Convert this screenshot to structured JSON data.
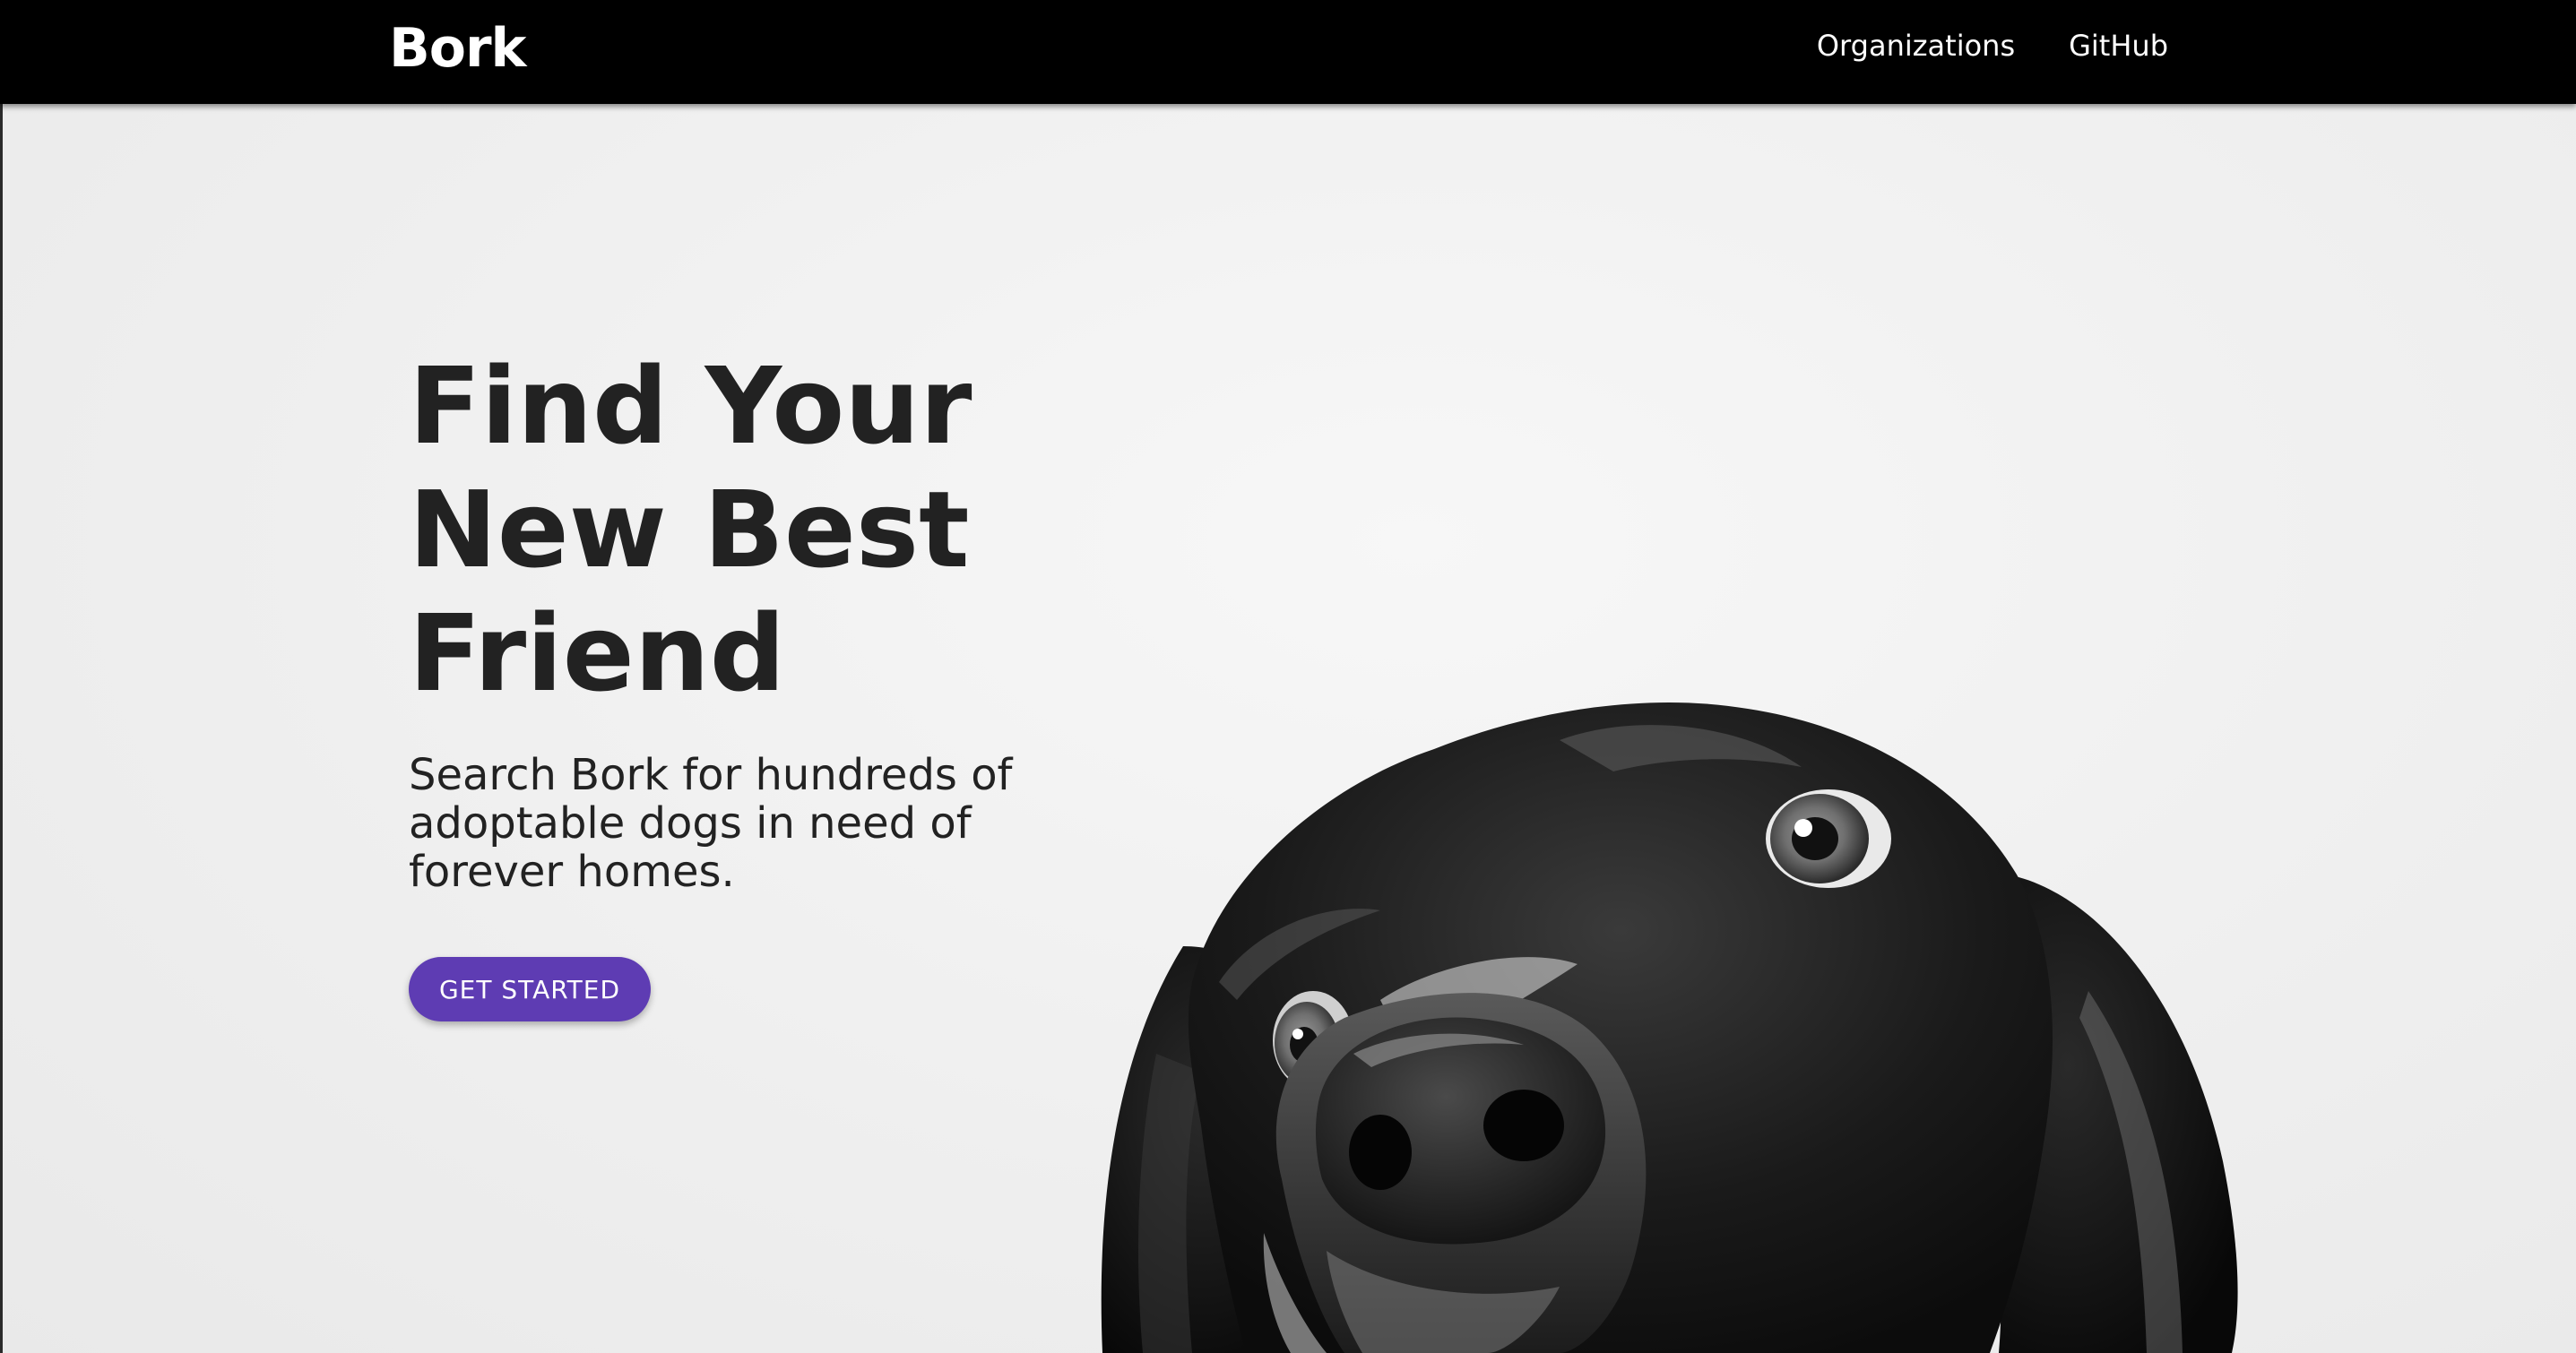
{
  "navbar": {
    "brand": "Bork",
    "links": [
      {
        "label": "Organizations"
      },
      {
        "label": "GitHub"
      }
    ]
  },
  "hero": {
    "title_lines": [
      "Find Your",
      "New Best",
      "Friend"
    ],
    "subtitle": "Search Bork for hundreds of adoptable dogs in need of forever homes.",
    "cta_label": "GET STARTED"
  },
  "colors": {
    "navbar_bg": "#000000",
    "accent": "#5e3cb3",
    "text": "#222222",
    "hero_bg": "#f2f2f2"
  },
  "icons": {
    "hero_image": "dog-photo"
  }
}
